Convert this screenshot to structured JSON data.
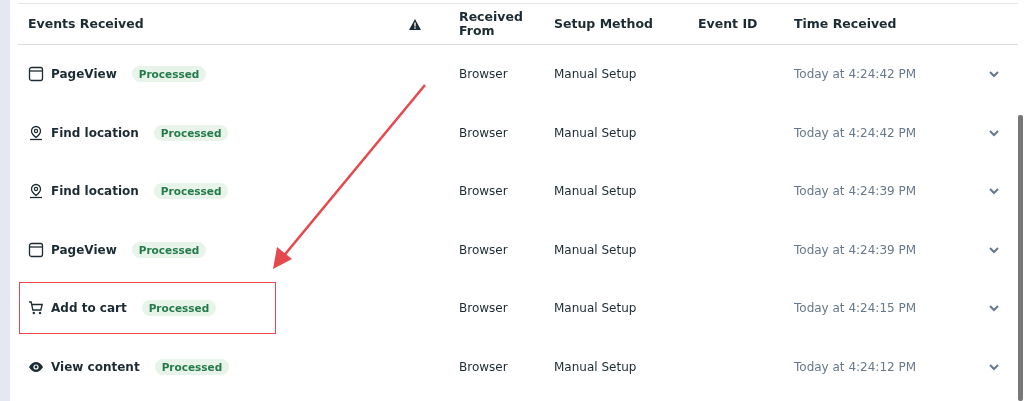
{
  "table": {
    "columns": [
      "Events Received",
      "Received From",
      "Setup Method",
      "Event ID",
      "Time Received"
    ],
    "rows": [
      {
        "kind": "browser",
        "event": "PageView",
        "status": "Processed",
        "received_from": "Browser",
        "setup_method": "Manual Setup",
        "time": "Today at 4:24:42 PM",
        "highlighted": false
      },
      {
        "kind": "location",
        "event": "Find location",
        "status": "Processed",
        "received_from": "Browser",
        "setup_method": "Manual Setup",
        "time": "Today at 4:24:42 PM",
        "highlighted": false
      },
      {
        "kind": "location",
        "event": "Find location",
        "status": "Processed",
        "received_from": "Browser",
        "setup_method": "Manual Setup",
        "time": "Today at 4:24:39 PM",
        "highlighted": false
      },
      {
        "kind": "browser",
        "event": "PageView",
        "status": "Processed",
        "received_from": "Browser",
        "setup_method": "Manual Setup",
        "time": "Today at 4:24:39 PM",
        "highlighted": false
      },
      {
        "kind": "cart",
        "event": "Add to cart",
        "status": "Processed",
        "received_from": "Browser",
        "setup_method": "Manual Setup",
        "time": "Today at 4:24:15 PM",
        "highlighted": true
      },
      {
        "kind": "eye",
        "event": "View content",
        "status": "Processed",
        "received_from": "Browser",
        "setup_method": "Manual Setup",
        "time": "Today at 4:24:12 PM",
        "highlighted": false
      }
    ]
  }
}
